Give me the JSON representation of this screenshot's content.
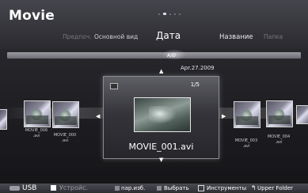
{
  "header": {
    "title": "Movie",
    "tabs": [
      {
        "label": "Предпоч.",
        "state": "dim"
      },
      {
        "label": "Основной вид",
        "state": "normal"
      },
      {
        "label": "Дата",
        "state": "selected"
      },
      {
        "label": "Название",
        "state": "normal"
      },
      {
        "label": "Папка",
        "state": "dim"
      }
    ],
    "page_indicator": {
      "pages": 5,
      "current": 2
    }
  },
  "index_bar": {
    "marker": "A/Ø"
  },
  "focus": {
    "date": "Apr.27.2009",
    "counter": "1/5",
    "filename": "MOVIE_001.avi"
  },
  "thumbnails_left": [
    {
      "label": "MOVIE_006\n.avi"
    },
    {
      "label": "MOVIE_000\n.avi"
    }
  ],
  "thumbnails_right": [
    {
      "label": "MOVIE_003\n.avi"
    },
    {
      "label": "MOVIE_004\n.avi"
    }
  ],
  "footer": {
    "device": "USB",
    "device_button": "Устройс.",
    "favorites": "пар.изб.",
    "select": "Выбрать",
    "tools": "Инструменты",
    "return_icon": "↰",
    "upper_folder": "Upper Folder"
  },
  "icons": {
    "usb": "usb-icon",
    "device": "device-icon",
    "tools": "tools-icon",
    "return": "return-icon"
  },
  "colors": {
    "background": "#1b1b1f",
    "header": "#2a2a30",
    "text": "#ffffff",
    "dim_text": "#77777e"
  }
}
